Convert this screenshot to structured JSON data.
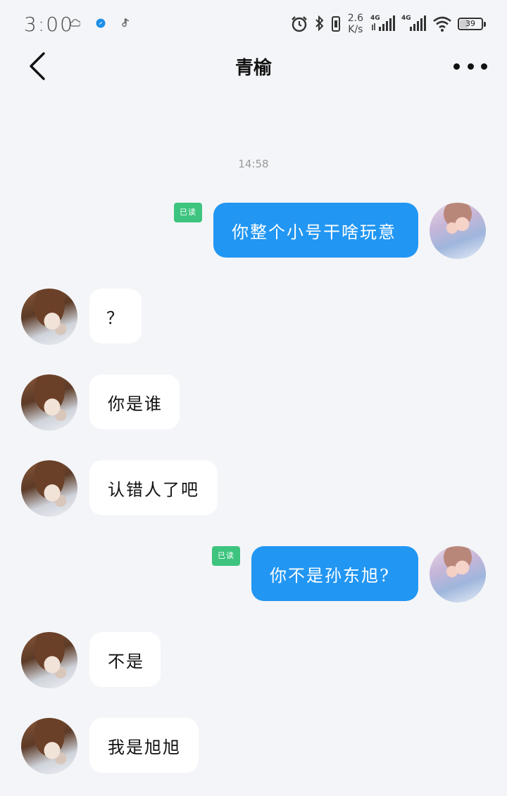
{
  "status_bar": {
    "time": "3:00",
    "network_speed_value": "2.6",
    "network_speed_unit": "K/s",
    "network_type_1": "4G",
    "network_type_2": "4G",
    "battery_level": "39",
    "battery_fraction": 0.39,
    "notification_icons": [
      "cloud-icon",
      "compass-icon",
      "music-note-icon"
    ],
    "system_icons": [
      "alarm-icon",
      "bluetooth-icon",
      "vibrate-icon",
      "signal-icon",
      "signal-icon",
      "wifi-icon",
      "battery-icon"
    ]
  },
  "header": {
    "title": "青榆",
    "back_icon": "chevron-left-icon",
    "more_icon": "more-dots-icon"
  },
  "chat": {
    "timestamp": "14:58",
    "read_label": "已读",
    "colors": {
      "sent_bubble": "#2196f3",
      "received_bubble": "#ffffff",
      "read_badge": "#3dc47e",
      "background": "#f4f5f8"
    },
    "messages": [
      {
        "direction": "sent",
        "text": "你整个小号干啥玩意",
        "read": "已读"
      },
      {
        "direction": "received",
        "text": "？"
      },
      {
        "direction": "received",
        "text": "你是谁"
      },
      {
        "direction": "received",
        "text": "认错人了吧"
      },
      {
        "direction": "sent",
        "text": "你不是孙东旭?",
        "read": "已读"
      },
      {
        "direction": "received",
        "text": "不是"
      },
      {
        "direction": "received",
        "text": "我是旭旭"
      }
    ]
  }
}
